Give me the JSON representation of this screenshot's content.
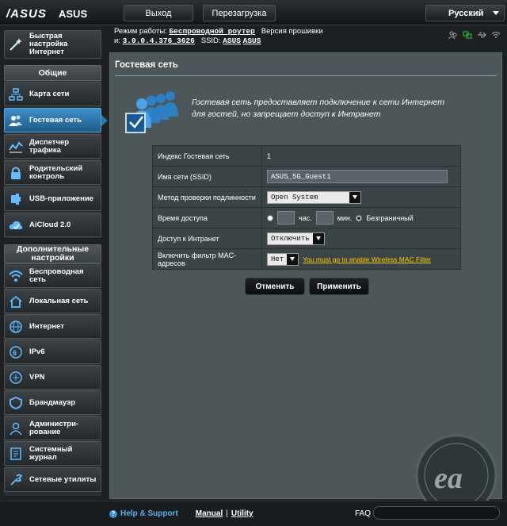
{
  "header": {
    "logo": "/ASUS",
    "brand": "ASUS",
    "logout_label": "Выход",
    "reboot_label": "Перезагрузка",
    "language": "Русский"
  },
  "info": {
    "mode_label": "Режим работы:",
    "mode_value": "Беспроводной роутер",
    "firmware_label": "Версия прошивки",
    "firmware_value": "3.0.0.4.376_3626",
    "ssid_label": "SSID:",
    "ssid_values": [
      "ASUS",
      "ASUS"
    ]
  },
  "sidebar": {
    "quick_setup": "Быстрая настройка Интернет",
    "general_header": "Общие",
    "general_items": [
      {
        "label": "Карта сети",
        "icon": "network-map-icon"
      },
      {
        "label": "Гостевая сеть",
        "icon": "guest-network-icon"
      },
      {
        "label": "Диспетчер трафика",
        "icon": "traffic-manager-icon"
      },
      {
        "label": "Родительский контроль",
        "icon": "parental-control-icon"
      },
      {
        "label": "USB-приложение",
        "icon": "usb-app-icon"
      },
      {
        "label": "AiCloud 2.0",
        "icon": "aicloud-icon"
      }
    ],
    "advanced_header": "Дополнительные настройки",
    "advanced_items": [
      {
        "label": "Беспроводная сеть",
        "icon": "wireless-icon"
      },
      {
        "label": "Локальная сеть",
        "icon": "lan-home-icon"
      },
      {
        "label": "Интернет",
        "icon": "globe-icon"
      },
      {
        "label": "IPv6",
        "icon": "ipv6-icon"
      },
      {
        "label": "VPN",
        "icon": "vpn-icon"
      },
      {
        "label": "Брандмауэр",
        "icon": "firewall-icon"
      },
      {
        "label": "Администри-рование",
        "icon": "admin-icon"
      },
      {
        "label": "Системный журнал",
        "icon": "syslog-icon"
      },
      {
        "label": "Сетевые утилиты",
        "icon": "tools-icon"
      }
    ]
  },
  "main": {
    "title": "Гостевая сеть",
    "description": "Гостевая сеть предоставляет подключение к сети Интернет для гостей, но запрещает доступ к Интранет",
    "fields": {
      "index_label": "Индекс Гостевая сеть",
      "index_value": "1",
      "ssid_label": "Имя сети (SSID)",
      "ssid_value": "ASUS_5G_Guest1",
      "auth_label": "Метод проверки подлинности",
      "auth_value": "Open System",
      "access_time_label": "Время доступа",
      "hours_unit": "час.",
      "minutes_unit": "мин.",
      "unlimited_label": "Безграничный",
      "intranet_label": "Доступ к Интранет",
      "intranet_value": "Отключить",
      "mac_filter_label": "Включить фильтр MAC-адресов",
      "mac_filter_value": "Нет",
      "mac_filter_link": "You must go to enable Wireless MAC Filter"
    },
    "cancel_label": "Отменить",
    "apply_label": "Применить"
  },
  "footer": {
    "help_label": "Help & Support",
    "manual_label": "Manual",
    "separator": "|",
    "utility_label": "Utility",
    "faq_label": "FAQ"
  },
  "colors": {
    "active_nav": "#2f74a8",
    "panel_bg": "#4d5659",
    "link_yellow": "#ffcc00"
  }
}
